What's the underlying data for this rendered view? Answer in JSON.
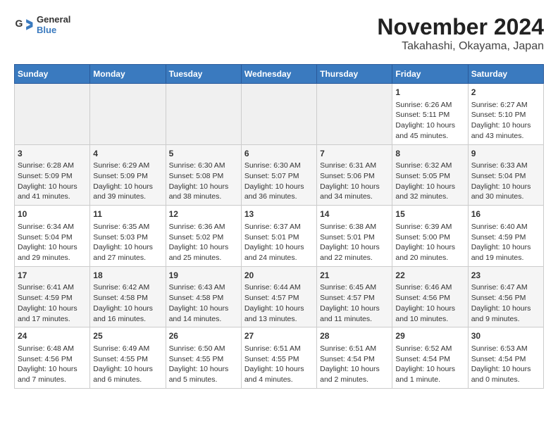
{
  "logo": {
    "line1": "General",
    "line2": "Blue"
  },
  "title": "November 2024",
  "subtitle": "Takahashi, Okayama, Japan",
  "headers": [
    "Sunday",
    "Monday",
    "Tuesday",
    "Wednesday",
    "Thursday",
    "Friday",
    "Saturday"
  ],
  "weeks": [
    [
      {
        "day": "",
        "data": ""
      },
      {
        "day": "",
        "data": ""
      },
      {
        "day": "",
        "data": ""
      },
      {
        "day": "",
        "data": ""
      },
      {
        "day": "",
        "data": ""
      },
      {
        "day": "1",
        "data": "Sunrise: 6:26 AM\nSunset: 5:11 PM\nDaylight: 10 hours and 45 minutes."
      },
      {
        "day": "2",
        "data": "Sunrise: 6:27 AM\nSunset: 5:10 PM\nDaylight: 10 hours and 43 minutes."
      }
    ],
    [
      {
        "day": "3",
        "data": "Sunrise: 6:28 AM\nSunset: 5:09 PM\nDaylight: 10 hours and 41 minutes."
      },
      {
        "day": "4",
        "data": "Sunrise: 6:29 AM\nSunset: 5:09 PM\nDaylight: 10 hours and 39 minutes."
      },
      {
        "day": "5",
        "data": "Sunrise: 6:30 AM\nSunset: 5:08 PM\nDaylight: 10 hours and 38 minutes."
      },
      {
        "day": "6",
        "data": "Sunrise: 6:30 AM\nSunset: 5:07 PM\nDaylight: 10 hours and 36 minutes."
      },
      {
        "day": "7",
        "data": "Sunrise: 6:31 AM\nSunset: 5:06 PM\nDaylight: 10 hours and 34 minutes."
      },
      {
        "day": "8",
        "data": "Sunrise: 6:32 AM\nSunset: 5:05 PM\nDaylight: 10 hours and 32 minutes."
      },
      {
        "day": "9",
        "data": "Sunrise: 6:33 AM\nSunset: 5:04 PM\nDaylight: 10 hours and 30 minutes."
      }
    ],
    [
      {
        "day": "10",
        "data": "Sunrise: 6:34 AM\nSunset: 5:04 PM\nDaylight: 10 hours and 29 minutes."
      },
      {
        "day": "11",
        "data": "Sunrise: 6:35 AM\nSunset: 5:03 PM\nDaylight: 10 hours and 27 minutes."
      },
      {
        "day": "12",
        "data": "Sunrise: 6:36 AM\nSunset: 5:02 PM\nDaylight: 10 hours and 25 minutes."
      },
      {
        "day": "13",
        "data": "Sunrise: 6:37 AM\nSunset: 5:01 PM\nDaylight: 10 hours and 24 minutes."
      },
      {
        "day": "14",
        "data": "Sunrise: 6:38 AM\nSunset: 5:01 PM\nDaylight: 10 hours and 22 minutes."
      },
      {
        "day": "15",
        "data": "Sunrise: 6:39 AM\nSunset: 5:00 PM\nDaylight: 10 hours and 20 minutes."
      },
      {
        "day": "16",
        "data": "Sunrise: 6:40 AM\nSunset: 4:59 PM\nDaylight: 10 hours and 19 minutes."
      }
    ],
    [
      {
        "day": "17",
        "data": "Sunrise: 6:41 AM\nSunset: 4:59 PM\nDaylight: 10 hours and 17 minutes."
      },
      {
        "day": "18",
        "data": "Sunrise: 6:42 AM\nSunset: 4:58 PM\nDaylight: 10 hours and 16 minutes."
      },
      {
        "day": "19",
        "data": "Sunrise: 6:43 AM\nSunset: 4:58 PM\nDaylight: 10 hours and 14 minutes."
      },
      {
        "day": "20",
        "data": "Sunrise: 6:44 AM\nSunset: 4:57 PM\nDaylight: 10 hours and 13 minutes."
      },
      {
        "day": "21",
        "data": "Sunrise: 6:45 AM\nSunset: 4:57 PM\nDaylight: 10 hours and 11 minutes."
      },
      {
        "day": "22",
        "data": "Sunrise: 6:46 AM\nSunset: 4:56 PM\nDaylight: 10 hours and 10 minutes."
      },
      {
        "day": "23",
        "data": "Sunrise: 6:47 AM\nSunset: 4:56 PM\nDaylight: 10 hours and 9 minutes."
      }
    ],
    [
      {
        "day": "24",
        "data": "Sunrise: 6:48 AM\nSunset: 4:56 PM\nDaylight: 10 hours and 7 minutes."
      },
      {
        "day": "25",
        "data": "Sunrise: 6:49 AM\nSunset: 4:55 PM\nDaylight: 10 hours and 6 minutes."
      },
      {
        "day": "26",
        "data": "Sunrise: 6:50 AM\nSunset: 4:55 PM\nDaylight: 10 hours and 5 minutes."
      },
      {
        "day": "27",
        "data": "Sunrise: 6:51 AM\nSunset: 4:55 PM\nDaylight: 10 hours and 4 minutes."
      },
      {
        "day": "28",
        "data": "Sunrise: 6:51 AM\nSunset: 4:54 PM\nDaylight: 10 hours and 2 minutes."
      },
      {
        "day": "29",
        "data": "Sunrise: 6:52 AM\nSunset: 4:54 PM\nDaylight: 10 hours and 1 minute."
      },
      {
        "day": "30",
        "data": "Sunrise: 6:53 AM\nSunset: 4:54 PM\nDaylight: 10 hours and 0 minutes."
      }
    ]
  ]
}
